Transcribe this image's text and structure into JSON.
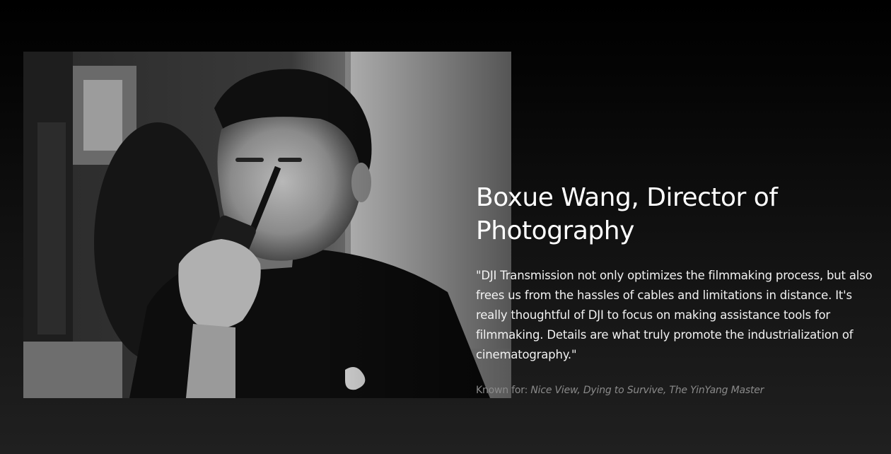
{
  "profile": {
    "name": "Boxue Wang, Director of Photography",
    "quote": "\"DJI Transmission not only optimizes the filmmaking process, but also frees us from the hassles of cables and limitations in distance. It's really thoughtful of DJI to focus on making assistance tools for filmmaking. Details are what truly promote the industrialization of cinematography.\"",
    "known_for_label": "Known for: ",
    "known_for_works": "Nice View, Dying to Survive, The YinYang Master"
  },
  "photo": {
    "subject": "black-and-white portrait of a man speaking into a walkie-talkie"
  },
  "colors": {
    "background_top": "#000000",
    "background_bottom": "#202020",
    "heading": "#ffffff",
    "body_text": "#f2f2f2",
    "muted_text": "#8a8a8a"
  }
}
